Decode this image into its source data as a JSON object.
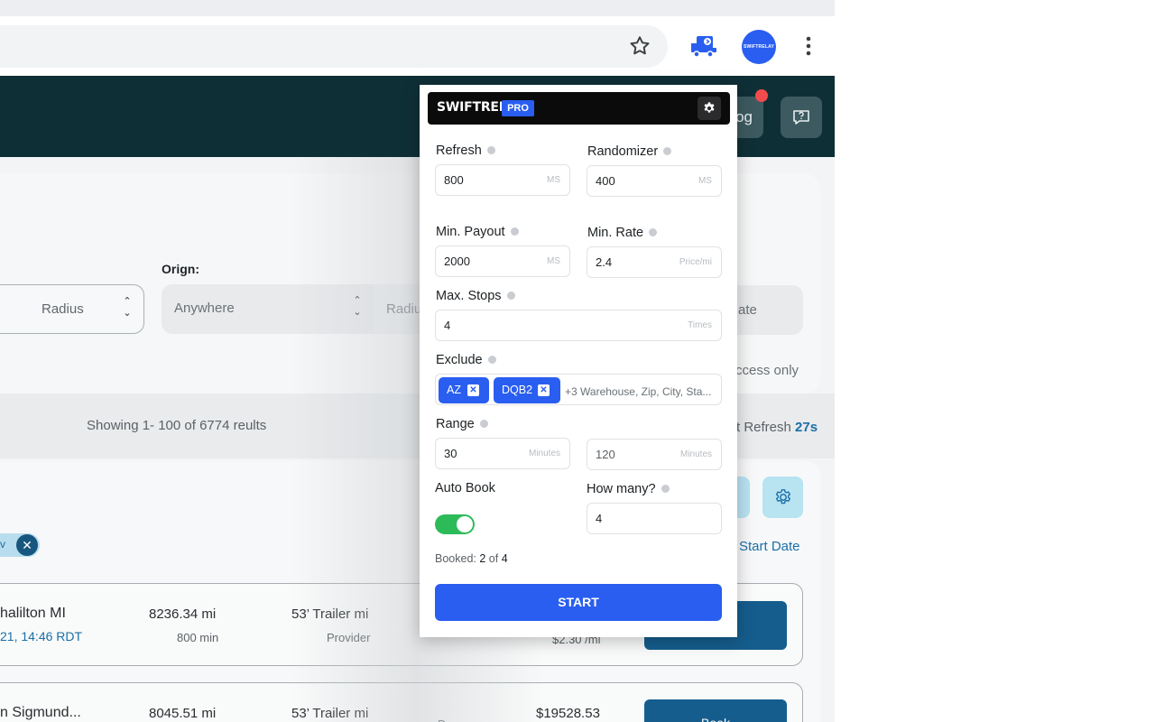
{
  "header": {
    "log_button_partial": "og"
  },
  "filters": {
    "origin_label": "Orign:",
    "radius_placeholder": "Radius",
    "origin_placeholder": "Anywhere",
    "radius2_partial": "Radiu",
    "date_partial": "ate",
    "access_partial": "ccess only"
  },
  "results": {
    "showing_text": "Showing 1- 100 of 6774 reults",
    "refresh_label": "t Refresh",
    "refresh_value": "27s",
    "start_date_label": "Start Date",
    "chip_partial": "v"
  },
  "rows": [
    {
      "origin": "halilton MI",
      "time": "21, 14:46 RDT",
      "distance": "8236.34 mi",
      "duration": "800 min",
      "equipment": "53’ Trailer mi",
      "provider": "Provider",
      "rate": "$2.30 /mi"
    },
    {
      "origin": "n Sigmund...",
      "distance": "8045.51 mi",
      "equipment": "53’ Trailer mi",
      "stop_type": "Drop",
      "price": "$19528.53",
      "book": "Book"
    }
  ],
  "popup": {
    "brand": "SWIFTRELAY",
    "badge": "PRO",
    "refresh": {
      "label": "Refresh",
      "value": "800",
      "unit": "MS"
    },
    "randomizer": {
      "label": "Randomizer",
      "value": "400",
      "unit": "MS"
    },
    "min_payout": {
      "label": "Min. Payout",
      "value": "2000",
      "unit": "MS"
    },
    "min_rate": {
      "label": "Min. Rate",
      "value": "2.4",
      "unit": "Price/mi"
    },
    "max_stops": {
      "label": "Max. Stops",
      "value": "4",
      "unit": "Times"
    },
    "exclude": {
      "label": "Exclude",
      "tags": [
        "AZ",
        "DQB2"
      ],
      "more": "+3",
      "placeholder": "Warehouse, Zip, City, Sta..."
    },
    "range": {
      "label": "Range",
      "min": "30",
      "max": "120",
      "unit": "Minutes"
    },
    "auto_book": {
      "label": "Auto Book",
      "enabled": true
    },
    "how_many": {
      "label": "How many?",
      "value": "4"
    },
    "booked": {
      "prefix": "Booked:",
      "count": "2",
      "of": "of",
      "total": "4"
    },
    "start": "START"
  },
  "extension_avatar_text": "SWIFTRELAY",
  "colors": {
    "accent": "#2a5ef0",
    "header": "#0f2f36",
    "toggle_on": "#2dbb5a",
    "link": "#1a6fa8"
  }
}
